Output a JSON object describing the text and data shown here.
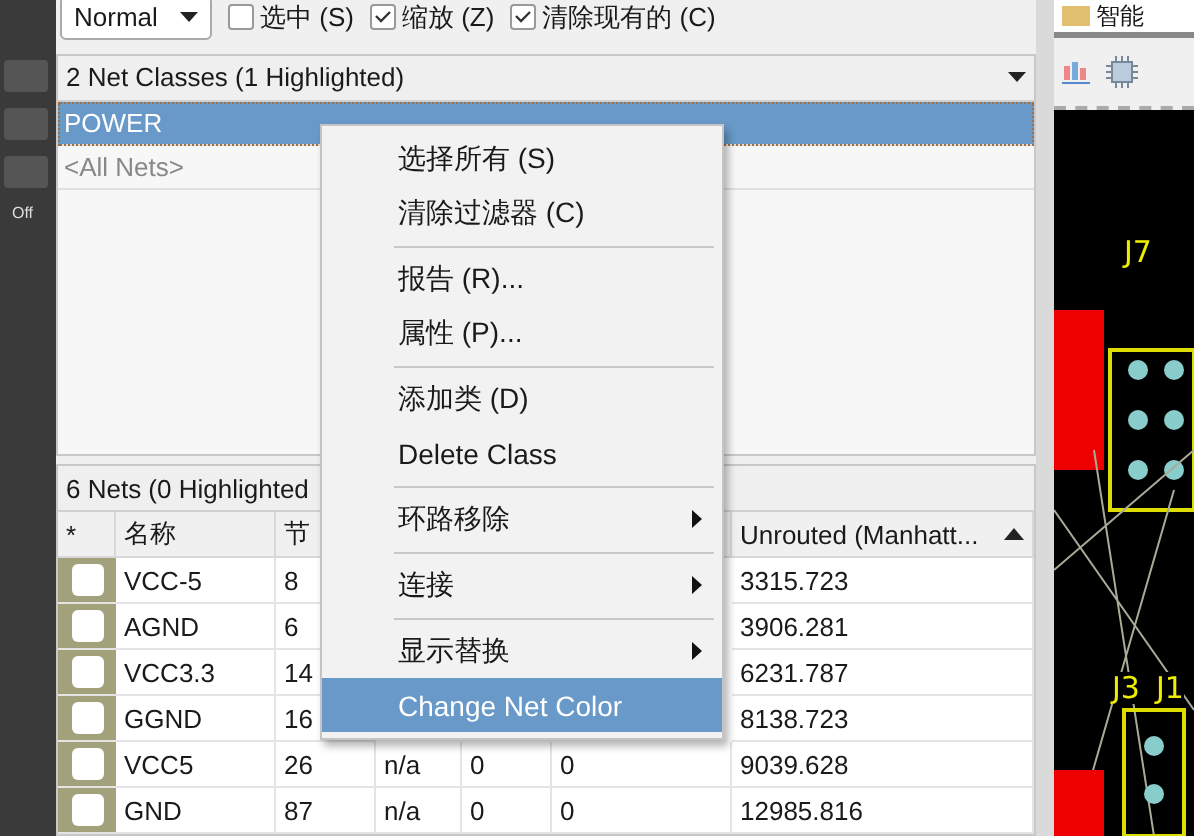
{
  "toolbar": {
    "mode": "Normal",
    "options": [
      {
        "label": "选中 (S)",
        "checked": false
      },
      {
        "label": "缩放 (Z)",
        "checked": true
      },
      {
        "label": "清除现有的 (C)",
        "checked": true
      }
    ]
  },
  "net_classes": {
    "header": "2 Net Classes (1 Highlighted)",
    "items": [
      {
        "label": "POWER",
        "selected": true
      },
      {
        "label": "<All Nets>",
        "selected": false
      }
    ]
  },
  "nets": {
    "header": "6 Nets (0 Highlighted",
    "columns": [
      "*",
      "名称",
      "节",
      "Unrouted (Manhatt..."
    ],
    "rows": [
      {
        "name": "VCC-5",
        "nodes": "8",
        "unrouted": "3315.723"
      },
      {
        "name": "AGND",
        "nodes": "6",
        "unrouted": "3906.281"
      },
      {
        "name": "VCC3.3",
        "nodes": "14",
        "unrouted": "6231.787"
      },
      {
        "name": "GGND",
        "nodes": "16",
        "unrouted": "8138.723"
      },
      {
        "name": "VCC5",
        "nodes": "26",
        "column_4": "n/a",
        "column_5": "0",
        "column_6": "0",
        "unrouted": "9039.628"
      },
      {
        "name": "GND",
        "nodes": "87",
        "column_4": "n/a",
        "column_5": "0",
        "column_6": "0",
        "unrouted": "12985.816"
      }
    ]
  },
  "context_menu": [
    {
      "kind": "item",
      "label": "选择所有 (S)",
      "submenu": false,
      "selected": false
    },
    {
      "kind": "item",
      "label": "清除过滤器 (C)",
      "submenu": false,
      "selected": false
    },
    {
      "kind": "separator"
    },
    {
      "kind": "item",
      "label": "报告 (R)...",
      "submenu": false,
      "selected": false
    },
    {
      "kind": "item",
      "label": "属性 (P)...",
      "submenu": false,
      "selected": false
    },
    {
      "kind": "separator"
    },
    {
      "kind": "item",
      "label": "添加类 (D)",
      "submenu": false,
      "selected": false
    },
    {
      "kind": "item",
      "label": "Delete Class",
      "submenu": false,
      "selected": false
    },
    {
      "kind": "separator"
    },
    {
      "kind": "item",
      "label": "环路移除",
      "submenu": true,
      "selected": false
    },
    {
      "kind": "separator"
    },
    {
      "kind": "item",
      "label": "连接",
      "submenu": true,
      "selected": false
    },
    {
      "kind": "separator"
    },
    {
      "kind": "item",
      "label": "显示替换",
      "submenu": true,
      "selected": false
    },
    {
      "kind": "item",
      "label": "Change Net Color",
      "submenu": false,
      "selected": true
    }
  ],
  "left_strip": {
    "label": "Off"
  },
  "pcb": {
    "tab": "智能",
    "labels": [
      "J7",
      "J3",
      "J1"
    ]
  }
}
